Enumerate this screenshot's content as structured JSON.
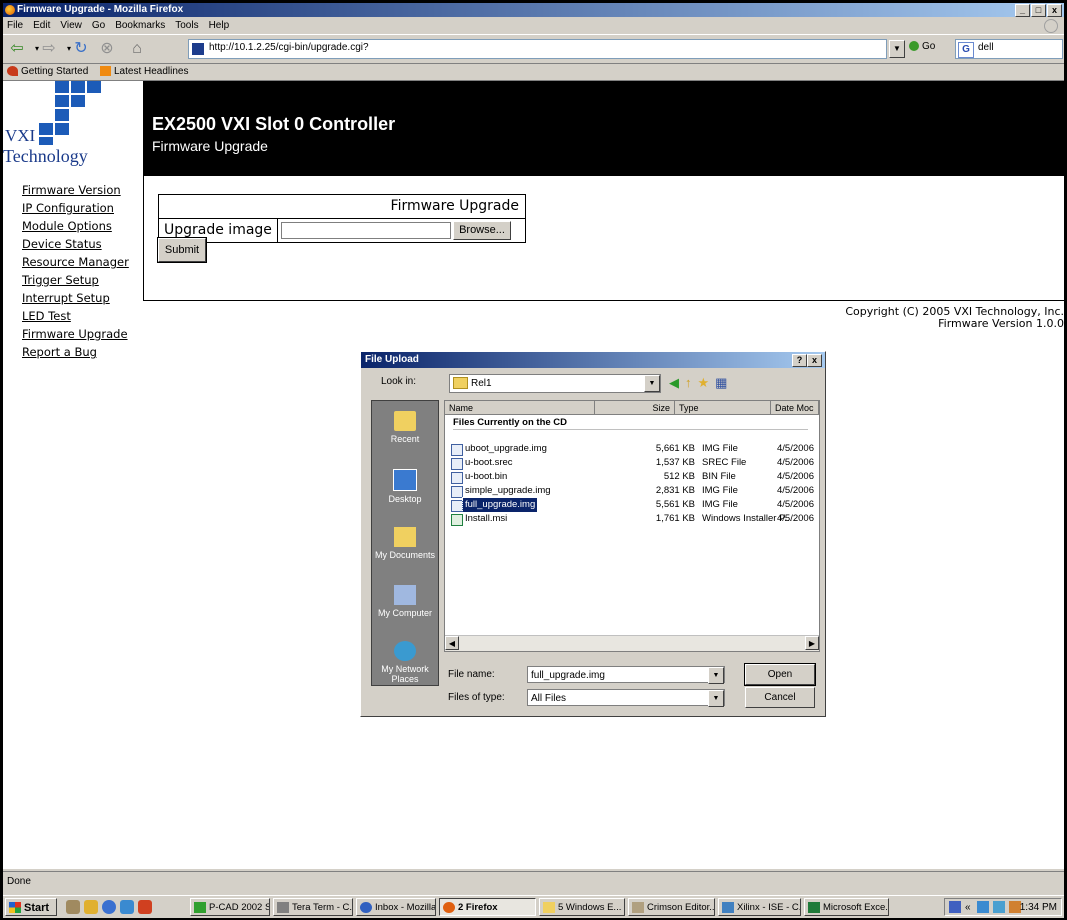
{
  "window": {
    "title": "Firmware Upgrade - Mozilla Firefox",
    "controls": [
      "_",
      "□",
      "x"
    ]
  },
  "menu": [
    "File",
    "Edit",
    "View",
    "Go",
    "Bookmarks",
    "Tools",
    "Help"
  ],
  "nav": {
    "url": "http://10.1.2.25/cgi-bin/upgrade.cgi?",
    "go_label": "Go",
    "search_value": "dell"
  },
  "bookmarks": [
    "Getting Started",
    "Latest Headlines"
  ],
  "page": {
    "logo_line1": "VXI",
    "logo_line2": "Technology",
    "title": "EX2500 VXI Slot 0 Controller",
    "subtitle": "Firmware Upgrade",
    "nav_links": [
      "Firmware Version",
      "IP Configuration",
      "Module Options",
      "Device Status",
      "Resource Manager",
      "Trigger Setup",
      "Interrupt Setup",
      "LED Test",
      "Firmware Upgrade",
      "Report a Bug"
    ],
    "form": {
      "header": "Firmware Upgrade",
      "label": "Upgrade image",
      "file_value": "",
      "browse_label": "Browse...",
      "submit_label": "Submit"
    },
    "copyright": "Copyright (C) 2005 VXI Technology, Inc.",
    "firmware_version": "Firmware Version 1.0.0"
  },
  "dialog": {
    "title": "File Upload",
    "help_btn": "?",
    "close_btn": "x",
    "look_in_label": "Look in:",
    "look_in_value": "Rel1",
    "places": [
      "Recent",
      "Desktop",
      "My Documents",
      "My Computer",
      "My Network Places"
    ],
    "columns": [
      "Name",
      "Size",
      "Type",
      "Date Moc"
    ],
    "group_header": "Files Currently on the CD",
    "files": [
      {
        "name": "uboot_upgrade.img",
        "size": "5,661 KB",
        "type": "IMG File",
        "date": "4/5/2006"
      },
      {
        "name": "u-boot.srec",
        "size": "1,537 KB",
        "type": "SREC File",
        "date": "4/5/2006"
      },
      {
        "name": "u-boot.bin",
        "size": "512 KB",
        "type": "BIN File",
        "date": "4/5/2006"
      },
      {
        "name": "simple_upgrade.img",
        "size": "2,831 KB",
        "type": "IMG File",
        "date": "4/5/2006"
      },
      {
        "name": "full_upgrade.img",
        "size": "5,561 KB",
        "type": "IMG File",
        "date": "4/5/2006"
      },
      {
        "name": "Install.msi",
        "size": "1,761 KB",
        "type": "Windows Installer P...",
        "date": "4/5/2006"
      }
    ],
    "selected_file": "full_upgrade.img",
    "file_name_label": "File name:",
    "file_name_value": "full_upgrade.img",
    "file_type_label": "Files of type:",
    "file_type_value": "All Files",
    "open_label": "Open",
    "cancel_label": "Cancel"
  },
  "status": "Done",
  "taskbar": {
    "start": "Start",
    "tasks": [
      "P-CAD 2002 S...",
      "Tera Term - C...",
      "Inbox - Mozilla...",
      "2 Firefox",
      "5 Windows E...",
      "Crimson Editor...",
      "Xilinx - ISE - C...",
      "Microsoft Exce..."
    ],
    "active_task": "2 Firefox",
    "clock": "1:34 PM"
  }
}
